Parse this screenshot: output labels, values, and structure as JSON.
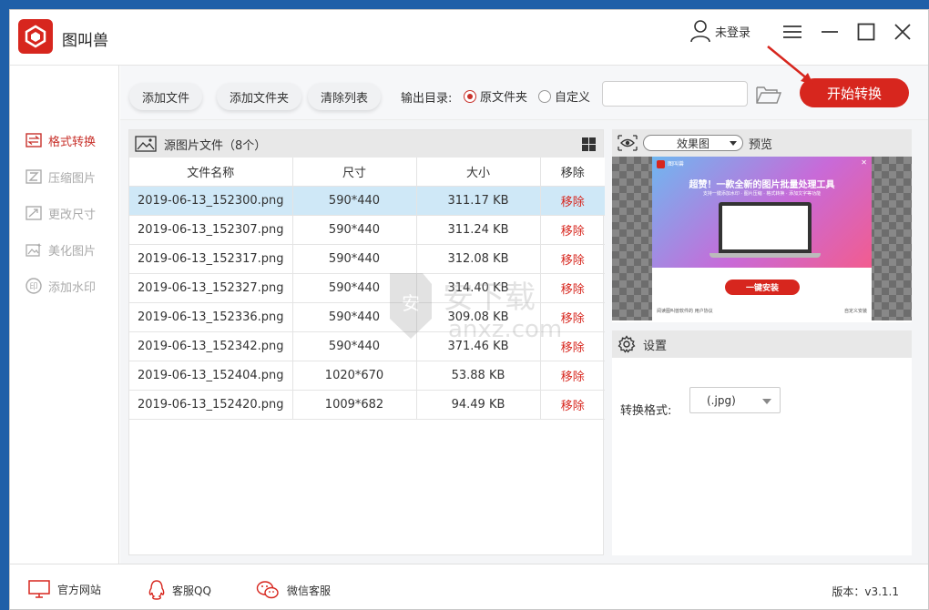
{
  "app": {
    "title": "图叫兽",
    "user_label": "未登录"
  },
  "sidebar": {
    "items": [
      {
        "label": "格式转换",
        "icon": "convert-icon",
        "active": true
      },
      {
        "label": "压缩图片",
        "icon": "compress-icon",
        "active": false
      },
      {
        "label": "更改尺寸",
        "icon": "resize-icon",
        "active": false
      },
      {
        "label": "美化图片",
        "icon": "beautify-icon",
        "active": false
      },
      {
        "label": "添加水印",
        "icon": "watermark-icon",
        "active": false
      }
    ]
  },
  "toolbar": {
    "add_file": "添加文件",
    "add_folder": "添加文件夹",
    "clear_list": "清除列表",
    "output_label": "输出目录:",
    "radio_original": "原文件夹",
    "radio_custom": "自定义",
    "selected_output": "原文件夹",
    "path_value": "",
    "start_button": "开始转换"
  },
  "file_list": {
    "title": "源图片文件（8个）",
    "columns": [
      "文件名称",
      "尺寸",
      "大小",
      "移除"
    ],
    "rows": [
      {
        "name": "2019-06-13_152300.png",
        "size": "590*440",
        "filesize": "311.17 KB",
        "action": "移除",
        "selected": true
      },
      {
        "name": "2019-06-13_152307.png",
        "size": "590*440",
        "filesize": "311.24 KB",
        "action": "移除"
      },
      {
        "name": "2019-06-13_152317.png",
        "size": "590*440",
        "filesize": "312.08 KB",
        "action": "移除"
      },
      {
        "name": "2019-06-13_152327.png",
        "size": "590*440",
        "filesize": "314.40 KB",
        "action": "移除"
      },
      {
        "name": "2019-06-13_152336.png",
        "size": "590*440",
        "filesize": "309.08 KB",
        "action": "移除"
      },
      {
        "name": "2019-06-13_152342.png",
        "size": "590*440",
        "filesize": "371.46 KB",
        "action": "移除"
      },
      {
        "name": "2019-06-13_152404.png",
        "size": "1020*670",
        "filesize": "53.88 KB",
        "action": "移除"
      },
      {
        "name": "2019-06-13_152420.png",
        "size": "1009*682",
        "filesize": "94.49 KB",
        "action": "移除"
      }
    ]
  },
  "preview": {
    "mode": "效果图",
    "title": "预览",
    "image": {
      "app_name": "图叫兽",
      "headline": "超赞！一款全新的图片批量处理工具",
      "subline": "支持一键添加水印 · 图片压缩 · 格式转换 · 添加文字等功能",
      "install": "一键安装",
      "footer_left": "阅读图叫兽软件的 用户协议",
      "footer_right": "自定义安装"
    }
  },
  "settings": {
    "title": "设置",
    "format_label": "转换格式:",
    "format_value": "(.jpg)"
  },
  "footer": {
    "website": "官方网站",
    "qq": "客服QQ",
    "wechat": "微信客服",
    "version": "版本：v3.1.1"
  },
  "watermark": {
    "text": "安下载",
    "domain": "anxz.com"
  },
  "colors": {
    "accent": "#d7261e",
    "selected_row": "#cfe8f7",
    "header_bg": "#e8e8e8"
  }
}
